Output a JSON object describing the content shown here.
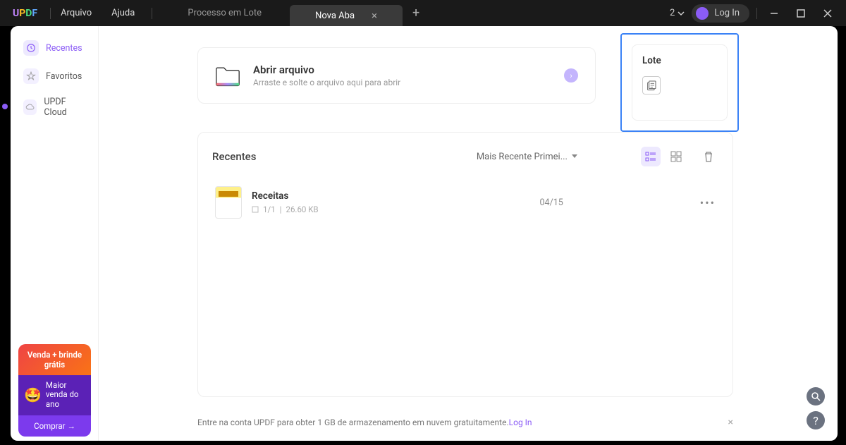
{
  "header": {
    "menu_file": "Arquivo",
    "menu_help": "Ajuda",
    "tab_inactive": "Processo em Lote",
    "tab_active": "Nova Aba",
    "counter": "2",
    "login": "Log In"
  },
  "sidebar": {
    "recent": "Recentes",
    "favorites": "Favoritos",
    "cloud": "UPDF Cloud"
  },
  "open_card": {
    "title": "Abrir arquivo",
    "subtitle": "Arraste e solte o arquivo aqui para abrir"
  },
  "lote": {
    "title": "Lote"
  },
  "recents": {
    "title": "Recentes",
    "sort": "Mais Recente Primei...",
    "file": {
      "name": "Receitas",
      "pages": "1/1",
      "size": "26.60 KB",
      "date": "04/15"
    }
  },
  "footer": {
    "text": "Entre na conta UPDF para obter 1 GB de armazenamento em nuvem gratuitamente.",
    "link": "Log In"
  },
  "promo": {
    "top": "Venda + brinde grátis",
    "mid": "Maior venda do ano",
    "btn": "Comprar →"
  }
}
